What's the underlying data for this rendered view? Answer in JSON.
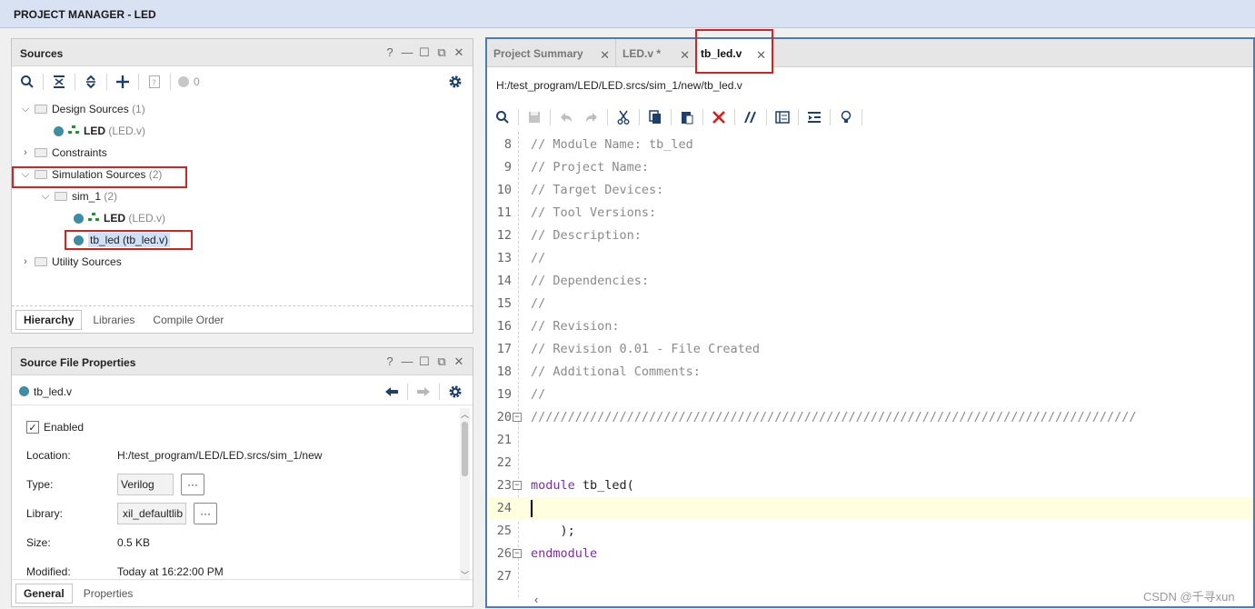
{
  "app": {
    "title": "PROJECT MANAGER - LED"
  },
  "window_controls": [
    "?",
    "—",
    "☐",
    "⧉",
    "✕"
  ],
  "sources": {
    "title": "Sources",
    "error_count": "0",
    "tree": {
      "design_sources": {
        "label": "Design Sources",
        "count": "(1)"
      },
      "design_led": {
        "name": "LED",
        "file": "(LED.v)"
      },
      "constraints": {
        "label": "Constraints"
      },
      "simulation_sources": {
        "label": "Simulation Sources",
        "count": "(2)"
      },
      "sim_1": {
        "label": "sim_1",
        "count": "(2)"
      },
      "sim_led": {
        "name": "LED",
        "file": "(LED.v)"
      },
      "tb_led": {
        "label": "tb_led (tb_led.v)"
      },
      "utility_sources": {
        "label": "Utility Sources"
      }
    },
    "tabs": [
      "Hierarchy",
      "Libraries",
      "Compile Order"
    ]
  },
  "properties": {
    "title": "Source File Properties",
    "file": "tb_led.v",
    "enabled_label": "Enabled",
    "enabled": true,
    "location_label": "Location:",
    "location": "H:/test_program/LED/LED.srcs/sim_1/new",
    "type_label": "Type:",
    "type": "Verilog",
    "library_label": "Library:",
    "library": "xil_defaultlib",
    "size_label": "Size:",
    "size": "0.5 KB",
    "modified_label": "Modified:",
    "modified": "Today at 16:22:00 PM",
    "more": "···",
    "tabs": [
      "General",
      "Properties"
    ]
  },
  "editor": {
    "tabs": [
      {
        "label": "Project Summary"
      },
      {
        "label": "LED.v *"
      },
      {
        "label": "tb_led.v"
      }
    ],
    "path": "H:/test_program/LED/LED.srcs/sim_1/new/tb_led.v",
    "lines": [
      {
        "n": "8",
        "text": "// Module Name: tb_led"
      },
      {
        "n": "9",
        "text": "// Project Name:"
      },
      {
        "n": "10",
        "text": "// Target Devices:"
      },
      {
        "n": "11",
        "text": "// Tool Versions:"
      },
      {
        "n": "12",
        "text": "// Description:"
      },
      {
        "n": "13",
        "text": "//"
      },
      {
        "n": "14",
        "text": "// Dependencies:"
      },
      {
        "n": "15",
        "text": "//"
      },
      {
        "n": "16",
        "text": "// Revision:"
      },
      {
        "n": "17",
        "text": "// Revision 0.01 - File Created"
      },
      {
        "n": "18",
        "text": "// Additional Comments:"
      },
      {
        "n": "19",
        "text": "//"
      },
      {
        "n": "20",
        "text": "//////////////////////////////////////////////////////////////////////////////////"
      },
      {
        "n": "21",
        "text": ""
      },
      {
        "n": "22",
        "text": ""
      },
      {
        "n": "23",
        "kw": "module",
        "text": " tb_led("
      },
      {
        "n": "24",
        "text": ""
      },
      {
        "n": "25",
        "text": "    );"
      },
      {
        "n": "26",
        "kw": "endmodule",
        "text": ""
      },
      {
        "n": "27",
        "text": ""
      }
    ]
  },
  "watermark": "CSDN @千寻xun",
  "colors": {
    "accent": "#4e7ab8",
    "highlight": "#d32424",
    "dot": "#3d8ea5",
    "keyword": "#7b2fa0",
    "current_line": "#ffffe0"
  }
}
